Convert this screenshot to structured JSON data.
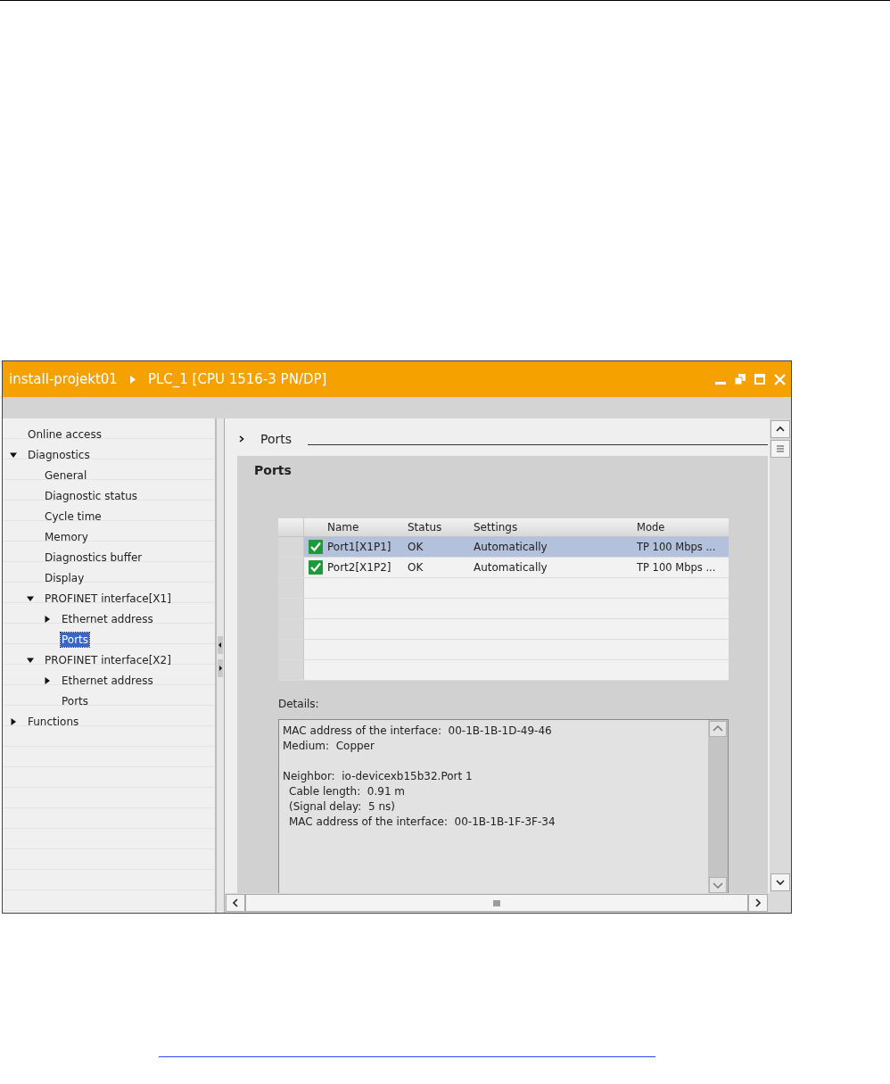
{
  "window": {
    "breadcrumb": [
      "install-projekt01",
      "PLC_1 [CPU 1516-3 PN/DP]"
    ]
  },
  "navigation": {
    "items": [
      {
        "label": "Online access",
        "selected": false
      },
      {
        "label": "Diagnostics",
        "selected": false,
        "expanded": true,
        "children": [
          {
            "label": "General",
            "selected": false
          },
          {
            "label": "Diagnostic status",
            "selected": false
          },
          {
            "label": "Cycle time",
            "selected": false
          },
          {
            "label": "Memory",
            "selected": false
          },
          {
            "label": "Diagnostics buffer",
            "selected": false
          },
          {
            "label": "Display",
            "selected": false
          },
          {
            "label": "PROFINET interface[X1]",
            "selected": false,
            "expanded": true,
            "children": [
              {
                "label": "Ethernet address",
                "selected": false,
                "expanded": false
              },
              {
                "label": "Ports",
                "selected": true
              }
            ]
          },
          {
            "label": "PROFINET interface[X2]",
            "selected": false,
            "expanded": true,
            "children": [
              {
                "label": "Ethernet address",
                "selected": false,
                "expanded": false
              },
              {
                "label": "Ports",
                "selected": false
              }
            ]
          }
        ]
      },
      {
        "label": "Functions",
        "selected": false,
        "expanded": false
      }
    ]
  },
  "section_header": "Ports",
  "panel": {
    "title": "Ports",
    "table": {
      "columns": [
        "Name",
        "Status",
        "Settings",
        "Mode"
      ],
      "rows": [
        {
          "name": "Port1[X1P1]",
          "status": "OK",
          "settings": "Automatically",
          "mode": "TP 100 Mbps ...",
          "selected": true
        },
        {
          "name": "Port2[X1P2]",
          "status": "OK",
          "settings": "Automatically",
          "mode": "TP 100 Mbps ...",
          "selected": false
        }
      ]
    },
    "details": {
      "label": "Details:",
      "groups": [
        {
          "lines": [
            "MAC address of the interface:  00-1B-1B-1D-49-46",
            "Medium:  Copper"
          ]
        },
        {
          "heading": "Neighbor:  io-devicexb15b32.Port 1",
          "lines": [
            "Cable length:  0.91 m",
            "(Signal delay:  5 ns)",
            "MAC address of the interface:  00-1B-1B-1F-3F-34"
          ]
        }
      ]
    }
  }
}
